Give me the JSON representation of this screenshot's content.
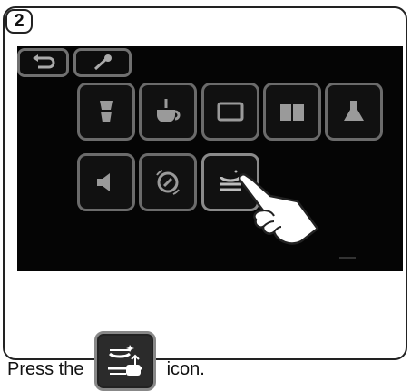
{
  "step": {
    "number": "2"
  },
  "screen": {
    "top_buttons": [
      {
        "name": "back",
        "icon": "back-arrow-icon"
      },
      {
        "name": "wrench",
        "icon": "wrench-icon"
      }
    ],
    "row1_icons": [
      "cup-stack-icon",
      "coffee-cup-icon",
      "window-icon",
      "book-icon",
      "flask-icon"
    ],
    "row2_icons": [
      "speaker-icon",
      "settings-dial-icon",
      "descaling-icon"
    ],
    "highlighted_icon": "descaling-icon"
  },
  "caption": {
    "prefix": "Press the",
    "suffix": "icon.",
    "icon": "descaling-icon"
  }
}
